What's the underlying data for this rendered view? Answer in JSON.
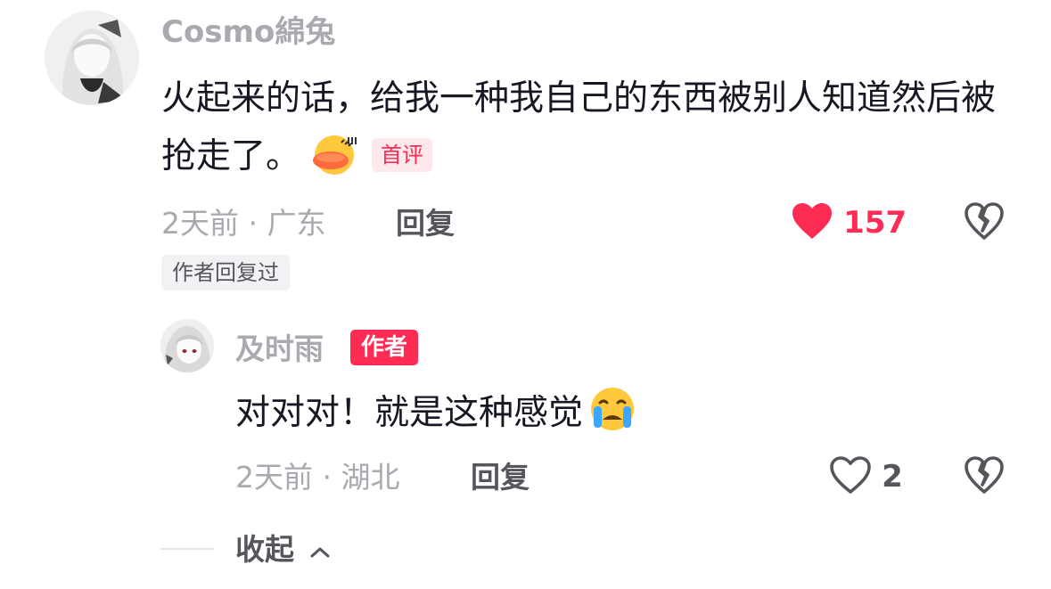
{
  "comment": {
    "username": "Cosmo綿兔",
    "text": "火起来的话，给我一种我自己的东西被别人知道然后被抢走了。",
    "emoji": "duck-emoji",
    "first_badge": "首评",
    "time_location": "2天前 · 广东",
    "reply_label": "回复",
    "like_count": "157",
    "liked": true,
    "author_replied_tag": "作者回复过"
  },
  "reply": {
    "username": "及时雨",
    "author_badge": "作者",
    "text": "对对对！就是这种感觉",
    "emoji": "crying-emoji",
    "time_location": "2天前 · 湖北",
    "reply_label": "回复",
    "like_count": "2",
    "liked": false
  },
  "collapse_label": "收起",
  "colors": {
    "accent_red": "#fe2c55",
    "muted_text": "#a9aab0",
    "secondary_text": "#55565c",
    "primary_text": "#161823"
  }
}
